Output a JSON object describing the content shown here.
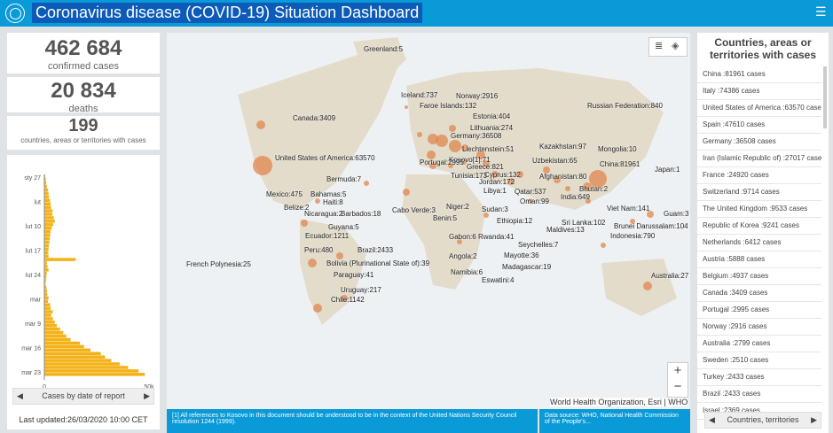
{
  "header": {
    "title": "Coronavirus disease (COVID-19) Situation Dashboard",
    "menu_icon": "hamburger-icon"
  },
  "stats": {
    "confirmed_value": "462 684",
    "confirmed_label": "confirmed cases",
    "deaths_value": "20 834",
    "deaths_label": "deaths",
    "countries_value": "199",
    "countries_label": "countries, areas or territories with cases"
  },
  "chart": {
    "nav_label": "Cases by date of report",
    "x_ticks": [
      "0",
      "50k"
    ],
    "y_ticks": [
      "sty 27",
      "lut",
      "lut 10",
      "lut 17",
      "lut 24",
      "mar",
      "mar 9",
      "mar 16",
      "mar 23"
    ],
    "bar_color": "#f3b21a"
  },
  "chart_data": {
    "type": "bar",
    "orientation": "horizontal",
    "xlim": [
      0,
      50000
    ],
    "values": [
      400,
      700,
      900,
      1200,
      1800,
      2000,
      2200,
      2700,
      3000,
      3200,
      3900,
      3800,
      4500,
      5000,
      4200,
      3500,
      3000,
      2800,
      2600,
      2400,
      2100,
      2000,
      1900,
      2000,
      15000,
      1200,
      1500,
      2000,
      1100,
      1000,
      800,
      600,
      1000,
      1300,
      1400,
      2000,
      1700,
      2800,
      3000,
      4000,
      3300,
      4100,
      5000,
      6000,
      7500,
      9000,
      10500,
      12500,
      17000,
      19000,
      22000,
      27000,
      29000,
      32000,
      36000,
      40000,
      45000,
      48000
    ]
  },
  "last_updated": "Last updated:26/03/2020 10:00 CET",
  "map": {
    "attribution": "World Health Organization, Esri | WHO",
    "zoom_in": "+",
    "zoom_out": "−",
    "labels": [
      {
        "t": "Greenland:5"
      },
      {
        "t": "Iceland:737"
      },
      {
        "t": "Norway:2916"
      },
      {
        "t": "Faroe Islands:132"
      },
      {
        "t": "Estonia:404"
      },
      {
        "t": "Lithuania:274"
      },
      {
        "t": "Germany:36508"
      },
      {
        "t": "Liechtenstein:51"
      },
      {
        "t": "Kosovo[1]:71"
      },
      {
        "t": "Greece:821"
      },
      {
        "t": "Cyprus:132"
      },
      {
        "t": "Jordan:172"
      },
      {
        "t": "Libya:1"
      },
      {
        "t": "Qatar:537"
      },
      {
        "t": "Oman:99"
      },
      {
        "t": "Russian Federation:840"
      },
      {
        "t": "Kazakhstan:97"
      },
      {
        "t": "Mongolia:10"
      },
      {
        "t": "Uzbekistan:65"
      },
      {
        "t": "China:81961"
      },
      {
        "t": "Japan:1"
      },
      {
        "t": "Afghanistan:80"
      },
      {
        "t": "Bhutan:2"
      },
      {
        "t": "India:649"
      },
      {
        "t": "Canada:3409"
      },
      {
        "t": "United States of America:63570"
      },
      {
        "t": "Bermuda:7"
      },
      {
        "t": "Mexico:475"
      },
      {
        "t": "Bahamas:5"
      },
      {
        "t": "Haiti:8"
      },
      {
        "t": "Belize:2"
      },
      {
        "t": "Nicaragua:2"
      },
      {
        "t": "Barbados:18"
      },
      {
        "t": "Guyana:5"
      },
      {
        "t": "Ecuador:1211"
      },
      {
        "t": "Peru:480"
      },
      {
        "t": "Brazil:2433"
      },
      {
        "t": "Bolivia (Plurinational State of):39"
      },
      {
        "t": "Paraguay:41"
      },
      {
        "t": "Uruguay:217"
      },
      {
        "t": "Chile:1142"
      },
      {
        "t": "French Polynesia:25"
      },
      {
        "t": "Portugal:2995"
      },
      {
        "t": "Tunisia:173"
      },
      {
        "t": "Niger:2"
      },
      {
        "t": "Cabo Verde:3"
      },
      {
        "t": "Benin:5"
      },
      {
        "t": "Sudan:3"
      },
      {
        "t": "Ethiopia:12"
      },
      {
        "t": "Gabon:6"
      },
      {
        "t": "Rwanda:41"
      },
      {
        "t": "Angola:2"
      },
      {
        "t": "Mayotte:36"
      },
      {
        "t": "Seychelles:7"
      },
      {
        "t": "Madagascar:19"
      },
      {
        "t": "Namibia:6"
      },
      {
        "t": "Eswatini:4"
      },
      {
        "t": "Maldives:13"
      },
      {
        "t": "Sri Lanka:102"
      },
      {
        "t": "Viet Nam:141"
      },
      {
        "t": "Brunei Darussalam:104"
      },
      {
        "t": "Indonesia:790"
      },
      {
        "t": "Guam:3"
      },
      {
        "t": "Australia:27"
      }
    ]
  },
  "footer": {
    "note": "[1] All references to Kosovo in this document should be understood to be in the context of the United Nations Security Council resolution 1244 (1999).",
    "source": "Data source: WHO, National Health Commission of the People's..."
  },
  "right_panel": {
    "title": "Countries, areas or territories with cases",
    "nav_label": "Countries, territories",
    "items": [
      "China :81961 cases",
      "Italy :74386 cases",
      "United States of America :63570 cases",
      "Spain :47610 cases",
      "Germany :36508 cases",
      "Iran (Islamic Republic of) :27017 cases",
      "France :24920 cases",
      "Switzerland :9714 cases",
      "The United Kingdom :9533 cases",
      "Republic of Korea :9241 cases",
      "Netherlands :6412 cases",
      "Austria :5888 cases",
      "Belgium :4937 cases",
      "Canada :3409 cases",
      "Portugal :2995 cases",
      "Norway :2916 cases",
      "Australia :2799 cases",
      "Sweden :2510 cases",
      "Turkey :2433 cases",
      "Brazil :2433 cases",
      "Israel :2369 cases"
    ]
  }
}
